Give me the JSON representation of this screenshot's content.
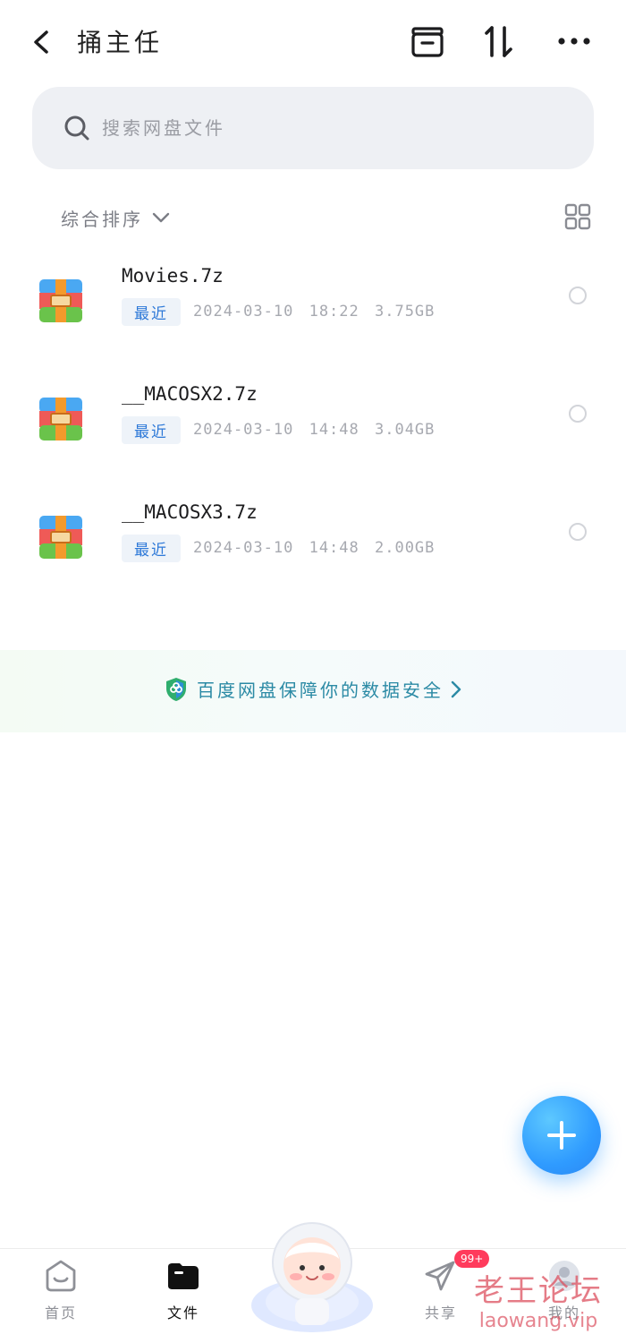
{
  "header": {
    "title": "捅主任",
    "back_icon": "chevron-left-icon",
    "archive_icon": "archive-box-icon",
    "sort_icon": "sort-arrows-icon",
    "more_icon": "more-dots-icon"
  },
  "search": {
    "placeholder": "搜索网盘文件",
    "icon": "search-icon"
  },
  "sort": {
    "label": "综合排序",
    "view_toggle_icon": "grid-view-icon"
  },
  "files": [
    {
      "name": "Movies.7z",
      "badge": "最近",
      "meta": "2024-03-10 18:22 3.75GB",
      "icon": "archive-7z-icon"
    },
    {
      "name": "__MACOSX2.7z",
      "badge": "最近",
      "meta": "2024-03-10 14:48 3.04GB",
      "icon": "archive-7z-icon"
    },
    {
      "name": "__MACOSX3.7z",
      "badge": "最近",
      "meta": "2024-03-10 14:48 2.00GB",
      "icon": "archive-7z-icon"
    }
  ],
  "safety_banner": {
    "text": "百度网盘保障你的数据安全",
    "icon": "shield-icon"
  },
  "fab": {
    "icon": "plus-icon"
  },
  "tabbar": {
    "home": "首页",
    "files": "文件",
    "share": "共享",
    "mine": "我的",
    "share_badge": "99+"
  },
  "watermark": {
    "line1": "老王论坛",
    "line2": "laowang.vip"
  },
  "colors": {
    "accent": "#2f9bff",
    "badge_text": "#2e79d8",
    "safety_text": "#2b8aa5",
    "notify": "#ff3b5c"
  }
}
